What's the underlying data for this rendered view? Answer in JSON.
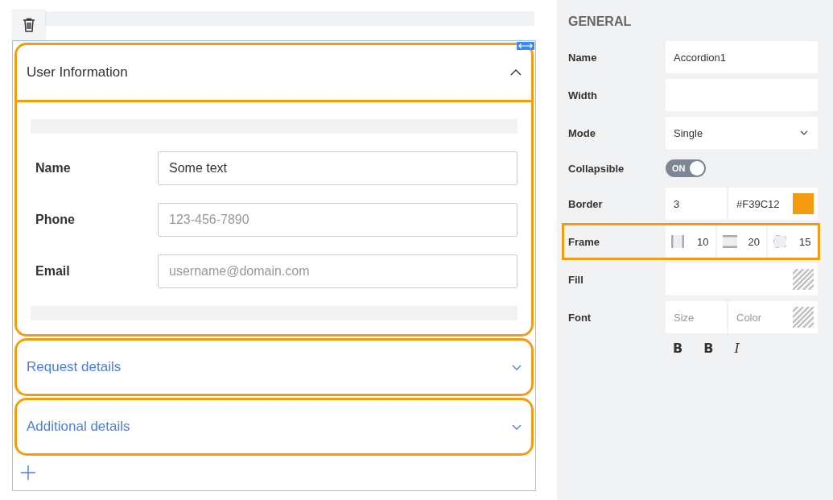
{
  "accordion": {
    "items": [
      {
        "title": "User Information",
        "expanded": true,
        "fields": [
          {
            "label": "Name",
            "value": "Some text"
          },
          {
            "label": "Phone",
            "placeholder": "123-456-7890"
          },
          {
            "label": "Email",
            "placeholder": "username@domain.com"
          }
        ]
      },
      {
        "title": "Request details",
        "expanded": false
      },
      {
        "title": "Additional details",
        "expanded": false
      }
    ]
  },
  "properties": {
    "section_title": "GENERAL",
    "rows": [
      {
        "kind": "text",
        "label": "Name",
        "value": "Accordion1",
        "selected": false
      },
      {
        "kind": "text",
        "label": "Width",
        "selected": false
      },
      {
        "kind": "select",
        "label": "Mode",
        "value": "Single",
        "selected": false
      },
      {
        "kind": "toggle",
        "label": "Collapsible",
        "on": true,
        "toggle_label": "ON",
        "selected": false
      },
      {
        "kind": "border",
        "label": "Border",
        "value": "3",
        "color_text": "#F39C12",
        "color": "#f39c12",
        "selected": false
      },
      {
        "kind": "frame",
        "label": "Frame",
        "values": [
          "10",
          "20",
          "15"
        ],
        "selected": true
      },
      {
        "kind": "fill",
        "label": "Fill",
        "selected": false
      },
      {
        "kind": "font",
        "label": "Font",
        "size_placeholder": "Size",
        "color_placeholder": "Color",
        "selected": false
      }
    ],
    "format_buttons": [
      {
        "label": "B",
        "kind": "bold"
      },
      {
        "label": "B",
        "kind": "bold"
      },
      {
        "label": "I",
        "kind": "italic"
      }
    ]
  }
}
